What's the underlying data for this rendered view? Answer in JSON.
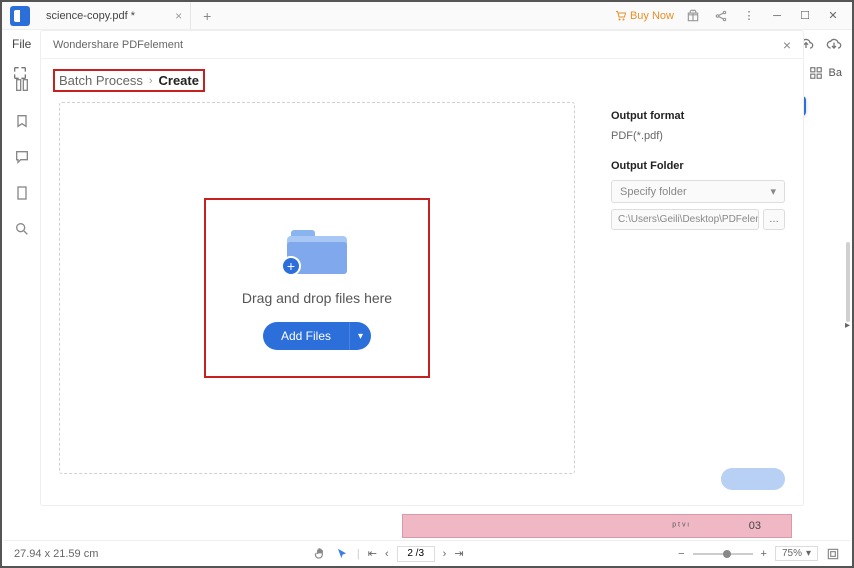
{
  "titlebar": {
    "tab_name": "science-copy.pdf *",
    "buy_now": "Buy Now"
  },
  "row2": {
    "file_label": "File"
  },
  "row3": {
    "ba_label": "Ba"
  },
  "modal": {
    "title": "Wondershare PDFelement",
    "breadcrumb": {
      "root": "Batch Process",
      "current": "Create"
    },
    "drop_text": "Drag and drop files here",
    "add_files": "Add Files",
    "output_format_label": "Output format",
    "output_format_value": "PDF(*.pdf)",
    "output_folder_label": "Output Folder",
    "folder_placeholder": "Specify folder",
    "folder_path": "C:\\Users\\Geili\\Desktop\\PDFelement\\Cr"
  },
  "pink": {
    "center": "ᵖᵗᵛᶦ",
    "num": "03"
  },
  "statusbar": {
    "dims": "27.94 x 21.59 cm",
    "page": "2 /3",
    "zoom": "75%"
  }
}
